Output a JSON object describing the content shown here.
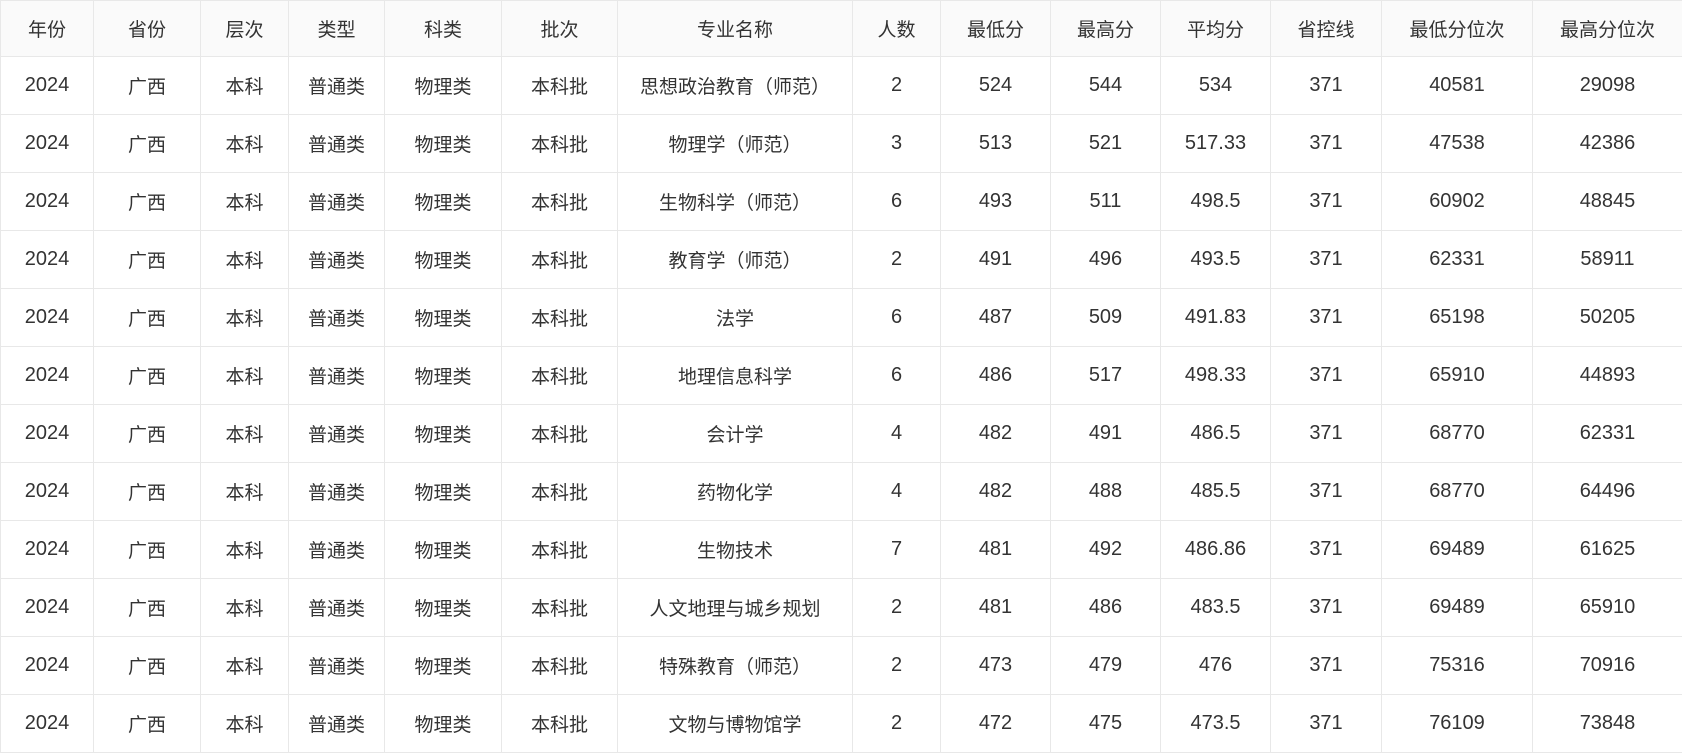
{
  "table": {
    "headers": [
      "年份",
      "省份",
      "层次",
      "类型",
      "科类",
      "批次",
      "专业名称",
      "人数",
      "最低分",
      "最高分",
      "平均分",
      "省控线",
      "最低分位次",
      "最高分位次"
    ],
    "rows": [
      [
        "2024",
        "广西",
        "本科",
        "普通类",
        "物理类",
        "本科批",
        "思想政治教育（师范）",
        "2",
        "524",
        "544",
        "534",
        "371",
        "40581",
        "29098"
      ],
      [
        "2024",
        "广西",
        "本科",
        "普通类",
        "物理类",
        "本科批",
        "物理学（师范）",
        "3",
        "513",
        "521",
        "517.33",
        "371",
        "47538",
        "42386"
      ],
      [
        "2024",
        "广西",
        "本科",
        "普通类",
        "物理类",
        "本科批",
        "生物科学（师范）",
        "6",
        "493",
        "511",
        "498.5",
        "371",
        "60902",
        "48845"
      ],
      [
        "2024",
        "广西",
        "本科",
        "普通类",
        "物理类",
        "本科批",
        "教育学（师范）",
        "2",
        "491",
        "496",
        "493.5",
        "371",
        "62331",
        "58911"
      ],
      [
        "2024",
        "广西",
        "本科",
        "普通类",
        "物理类",
        "本科批",
        "法学",
        "6",
        "487",
        "509",
        "491.83",
        "371",
        "65198",
        "50205"
      ],
      [
        "2024",
        "广西",
        "本科",
        "普通类",
        "物理类",
        "本科批",
        "地理信息科学",
        "6",
        "486",
        "517",
        "498.33",
        "371",
        "65910",
        "44893"
      ],
      [
        "2024",
        "广西",
        "本科",
        "普通类",
        "物理类",
        "本科批",
        "会计学",
        "4",
        "482",
        "491",
        "486.5",
        "371",
        "68770",
        "62331"
      ],
      [
        "2024",
        "广西",
        "本科",
        "普通类",
        "物理类",
        "本科批",
        "药物化学",
        "4",
        "482",
        "488",
        "485.5",
        "371",
        "68770",
        "64496"
      ],
      [
        "2024",
        "广西",
        "本科",
        "普通类",
        "物理类",
        "本科批",
        "生物技术",
        "7",
        "481",
        "492",
        "486.86",
        "371",
        "69489",
        "61625"
      ],
      [
        "2024",
        "广西",
        "本科",
        "普通类",
        "物理类",
        "本科批",
        "人文地理与城乡规划",
        "2",
        "481",
        "486",
        "483.5",
        "371",
        "69489",
        "65910"
      ],
      [
        "2024",
        "广西",
        "本科",
        "普通类",
        "物理类",
        "本科批",
        "特殊教育（师范）",
        "2",
        "473",
        "479",
        "476",
        "371",
        "75316",
        "70916"
      ],
      [
        "2024",
        "广西",
        "本科",
        "普通类",
        "物理类",
        "本科批",
        "文物与博物馆学",
        "2",
        "472",
        "475",
        "473.5",
        "371",
        "76109",
        "73848"
      ]
    ]
  }
}
